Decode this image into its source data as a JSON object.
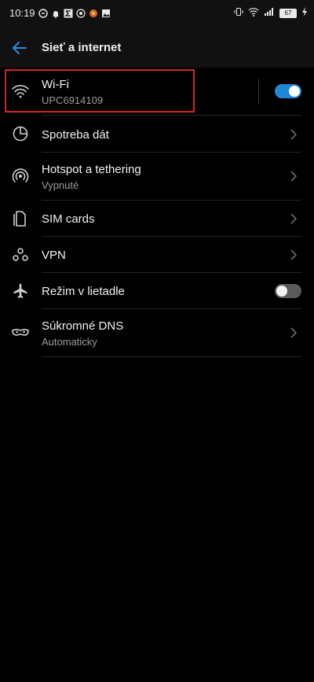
{
  "status_bar": {
    "time": "10:19",
    "battery": "67"
  },
  "header": {
    "title": "Sieť a internet"
  },
  "rows": {
    "wifi": {
      "label": "Wi-Fi",
      "sub": "UPC6914109",
      "toggle": true
    },
    "data_usage": {
      "label": "Spotreba dát"
    },
    "hotspot": {
      "label": "Hotspot a tethering",
      "sub": "Vypnuté"
    },
    "sim": {
      "label": "SIM cards"
    },
    "vpn": {
      "label": "VPN"
    },
    "airplane": {
      "label": "Režim v lietadle",
      "toggle": false
    },
    "dns": {
      "label": "Súkromné DNS",
      "sub": "Automaticky"
    }
  },
  "colors": {
    "accent": "#1e88d6",
    "highlight": "#d3242b"
  },
  "icons": {
    "back": "arrow-left-icon",
    "wifi": "wifi-icon",
    "data_usage": "pie-chart-icon",
    "hotspot": "hotspot-icon",
    "sim": "sim-card-icon",
    "vpn": "vpn-icon",
    "airplane": "airplane-icon",
    "dns": "mask-icon",
    "chevron": "chevron-right-icon"
  }
}
